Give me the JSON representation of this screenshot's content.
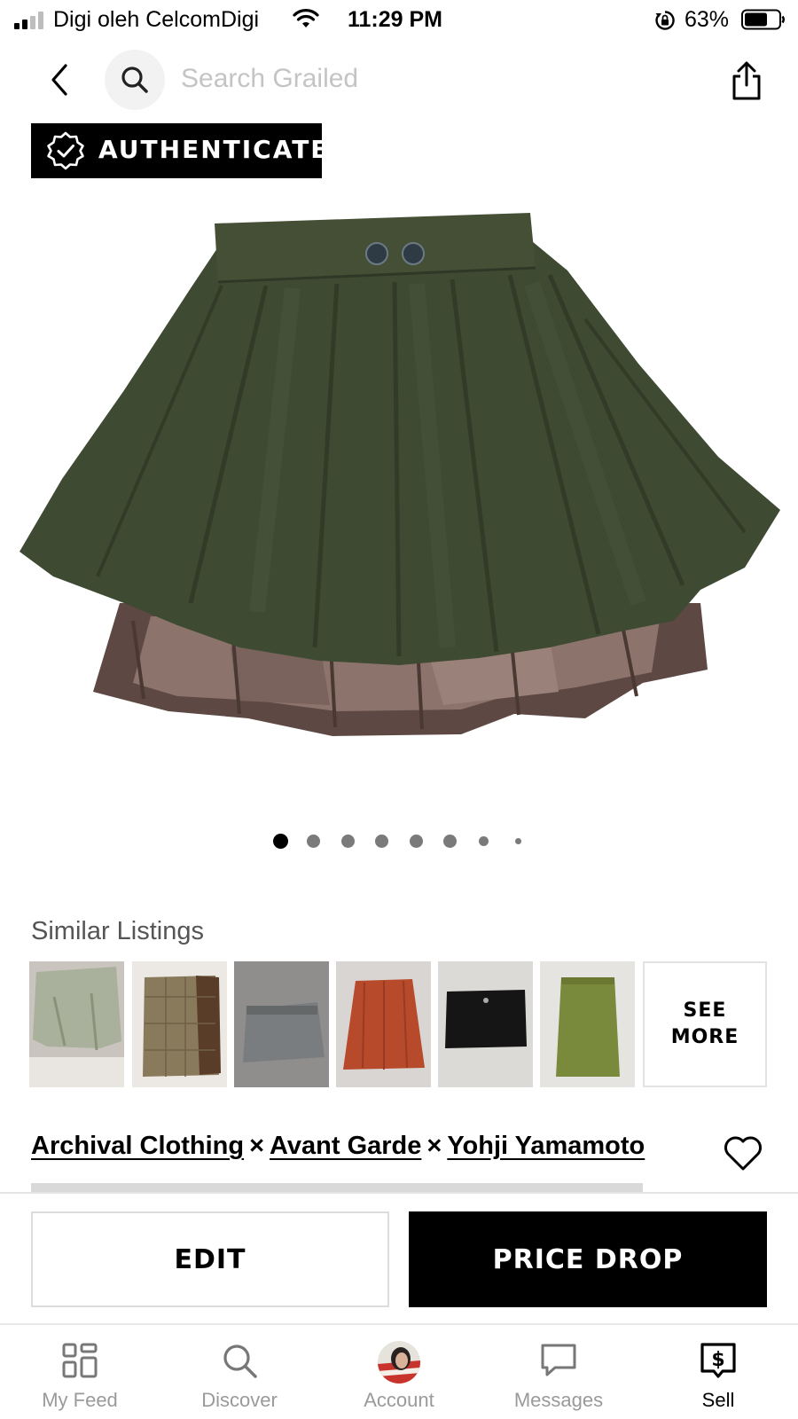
{
  "status_bar": {
    "carrier": "Digi oleh CelcomDigi",
    "time": "11:29 PM",
    "battery": "63%"
  },
  "header": {
    "search_placeholder": "Search Grailed",
    "icons": [
      "back-icon",
      "search-icon",
      "share-icon"
    ]
  },
  "badge": {
    "label": "AUTHENTICATED",
    "icon": "verified-check-icon"
  },
  "carousel": {
    "total": 8,
    "active_index": 0
  },
  "similar_listings": {
    "title": "Similar Listings",
    "items": [
      {
        "color": "#a9b09b"
      },
      {
        "color": "#8a7a5c"
      },
      {
        "color": "#7a7d80"
      },
      {
        "color": "#b84a2c"
      },
      {
        "color": "#151515"
      },
      {
        "color": "#7a8a3c"
      }
    ],
    "see_more": "SEE MORE"
  },
  "listing": {
    "brands": [
      "Archival Clothing",
      "Avant Garde",
      "Yohji Yamamoto"
    ],
    "separator": "×"
  },
  "actions": {
    "edit": "EDIT",
    "price_drop": "PRICE DROP"
  },
  "tab_bar": {
    "tabs": [
      {
        "label": "My Feed",
        "icon": "feed-grid-icon"
      },
      {
        "label": "Discover",
        "icon": "search-icon"
      },
      {
        "label": "Account",
        "icon": "avatar"
      },
      {
        "label": "Messages",
        "icon": "message-bubble-icon"
      },
      {
        "label": "Sell",
        "icon": "dollar-tag-icon"
      }
    ],
    "active": "Sell"
  },
  "colors": {
    "accent": "#000000",
    "muted_text": "#9a9a9a",
    "placeholder": "#c4c4c4",
    "skirt_green": "#3f4a32",
    "leather_brown": "#6b5550"
  }
}
